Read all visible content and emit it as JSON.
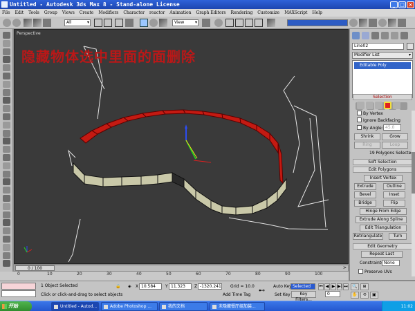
{
  "window": {
    "title": "Untitled - Autodesk 3ds Max 8  - Stand-alone License"
  },
  "menu": [
    "File",
    "Edit",
    "Tools",
    "Group",
    "Views",
    "Create",
    "Modifiers",
    "Character",
    "reactor",
    "Animation",
    "Graph Editors",
    "Rendering",
    "Customize",
    "MAXScript",
    "Help"
  ],
  "toolbar": {
    "filter": "All",
    "refcoord": "View"
  },
  "viewport": {
    "label": "Perspective",
    "overlay_text": "隐藏物体选中里面的面删除"
  },
  "timeline": {
    "slider": "0 / 100",
    "ticks": [
      "0",
      "10",
      "20",
      "30",
      "40",
      "50",
      "60",
      "70",
      "80",
      "90",
      "100"
    ]
  },
  "status": {
    "selection": "1 Object Selected",
    "prompt": "Click or click-and-drag to select objects",
    "x_label": "X",
    "x": "10.584",
    "y_label": "Y",
    "y": "11.323",
    "z_label": "Z",
    "z": "-1320.241",
    "grid": "Grid = 10.0",
    "add_time_tag": "Add Time Tag",
    "auto_key": "Auto Key",
    "key_mode": "Selected",
    "set_key": "Set Key",
    "key_filters": "Key Filters...",
    "frame": "0"
  },
  "command_panel": {
    "object_name": "Line02",
    "modifier_list": "Modifier List",
    "stack_item": "Editable Poly",
    "selection": {
      "title": "Selection",
      "by_vertex": "By Vertex",
      "ignore_backfacing": "Ignore Backfacing",
      "by_angle": "By Angle:",
      "angle": "45.0",
      "shrink": "Shrink",
      "grow": "Grow",
      "ring": "Ring",
      "loop": "Loop",
      "status": "19 Polygons Selected"
    },
    "soft_selection": "Soft Selection",
    "edit_polygons": {
      "title": "Edit Polygons",
      "insert_vertex": "Insert Vertex",
      "extrude": "Extrude",
      "outline": "Outline",
      "bevel": "Bevel",
      "inset": "Inset",
      "bridge": "Bridge",
      "flip": "Flip",
      "hinge": "Hinge From Edge",
      "extrude_spline": "Extrude Along Spline",
      "edit_triangulation": "Edit Triangulation",
      "retriangulate": "Retriangulate",
      "turn": "Turn"
    },
    "edit_geometry": {
      "title": "Edit Geometry",
      "repeat_last": "Repeat Last",
      "constraints_label": "Constraints:",
      "constraints": "None",
      "preserve_uvs": "Preserve UVs"
    }
  },
  "taskbar": {
    "start": "开始",
    "tasks": [
      "Untitled - Autod...",
      "Adobe Photoshop ...",
      "我的文档",
      "未隐藏餐厅组加装..."
    ],
    "clock": "11:02"
  },
  "colors": {
    "title_blue": "#2457cf",
    "selected_red": "#c41a12",
    "viewport_bg": "#3a3a3a"
  }
}
